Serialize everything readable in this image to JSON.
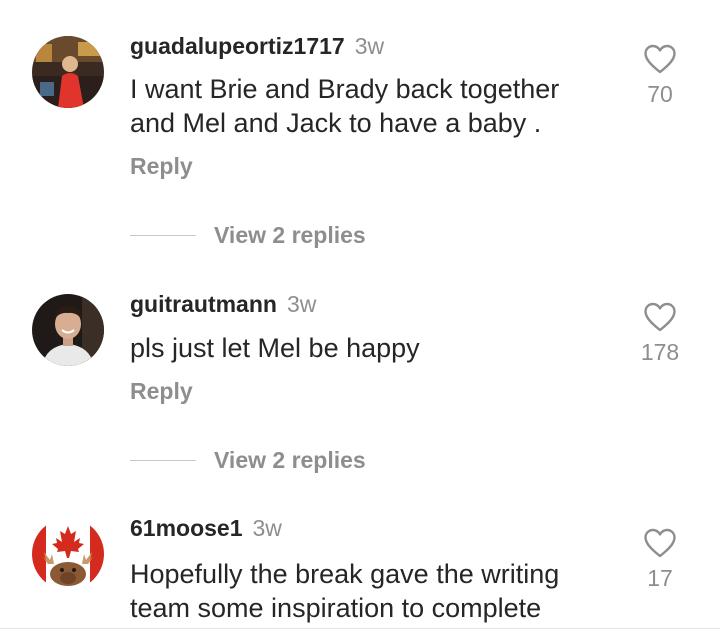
{
  "comments": [
    {
      "username": "guadalupeortiz1717",
      "age": "3w",
      "text": "I want Brie and Brady back together and Mel and Jack to have a baby .",
      "reply_label": "Reply",
      "likes": "70",
      "view_replies": "View 2 replies",
      "avatar_icon": "photo-person-red-dress-avatar"
    },
    {
      "username": "guitrautmann",
      "age": "3w",
      "text": "pls just let Mel be happy",
      "reply_label": "Reply",
      "likes": "178",
      "view_replies": "View 2 replies",
      "avatar_icon": "photo-smiling-man-avatar"
    },
    {
      "username": "61moose1",
      "age": "3w",
      "text": "Hopefully the break gave the writing team some inspiration to complete",
      "likes": "17",
      "avatar_icon": "canada-flag-moose-avatar"
    }
  ],
  "colors": {
    "primary_text": "#262626",
    "secondary_text": "#8e8e8e",
    "divider": "#c7c7c7",
    "canada_red": "#d52b1e"
  },
  "icons": {
    "like": "heart-outline-icon"
  }
}
